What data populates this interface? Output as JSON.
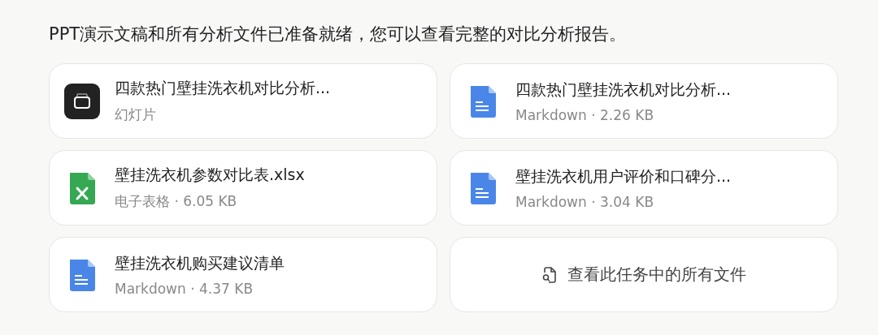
{
  "message": "PPT演示文稿和所有分析文件已准备就绪，您可以查看完整的对比分析报告。",
  "files": [
    {
      "kind": "slides",
      "name": "四款热门壁挂洗衣机对比分析...",
      "meta": "幻灯片"
    },
    {
      "kind": "doc",
      "name": "四款热门壁挂洗衣机对比分析...",
      "meta": "Markdown · 2.26 KB"
    },
    {
      "kind": "sheet",
      "name": "壁挂洗衣机参数对比表.xlsx",
      "meta": "电子表格 · 6.05 KB"
    },
    {
      "kind": "doc",
      "name": "壁挂洗衣机用户评价和口碑分...",
      "meta": "Markdown · 3.04 KB"
    },
    {
      "kind": "doc",
      "name": "壁挂洗衣机购买建议清单",
      "meta": "Markdown · 4.37 KB"
    }
  ],
  "view_all": {
    "label": "查看此任务中的所有文件"
  }
}
